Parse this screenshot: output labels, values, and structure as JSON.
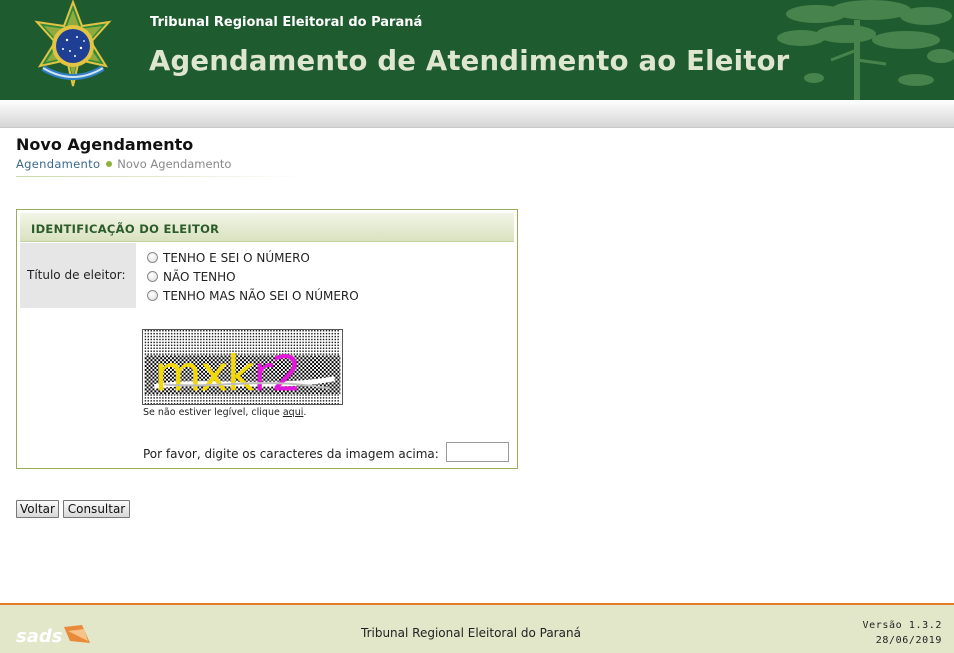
{
  "header": {
    "org": "Tribunal Regional Eleitoral do Paraná",
    "title": "Agendamento de Atendimento ao Eleitor"
  },
  "page": {
    "title": "Novo Agendamento",
    "breadcrumb": [
      "Agendamento",
      "Novo Agendamento"
    ]
  },
  "form": {
    "section_title": "IDENTIFICAÇÃO DO ELEITOR",
    "field_label": "Título de eleitor:",
    "options": [
      "TENHO E SEI O NÚMERO",
      "NÃO TENHO",
      "TENHO MAS NÃO SEI O NÚMERO"
    ],
    "captcha_text": "mxkr2",
    "captcha_hint_prefix": "Se não estiver legível, clique ",
    "captcha_hint_link": "aqui",
    "captcha_hint_suffix": ".",
    "captcha_prompt": "Por favor, digite os caracteres da imagem acima:",
    "captcha_value": ""
  },
  "buttons": {
    "back": "Voltar",
    "submit": "Consultar"
  },
  "footer": {
    "brand": "sads",
    "org": "Tribunal Regional Eleitoral do Paraná",
    "version": "Versão 1.3.2",
    "date": "28/06/2019"
  },
  "colors": {
    "header_bg": "#1e5c2f",
    "accent": "#9aae5a",
    "footer_bg": "#e3e7c9",
    "footer_line": "#e57a2a"
  }
}
